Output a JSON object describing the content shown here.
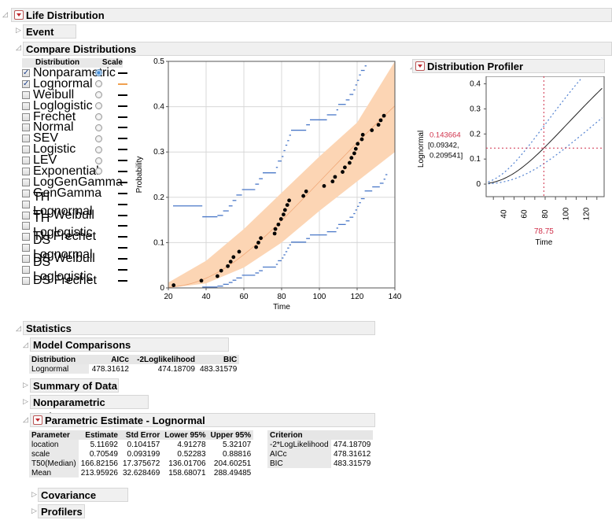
{
  "life_distribution": {
    "title": "Life Distribution"
  },
  "event_plot": {
    "title": "Event Plot"
  },
  "compare": {
    "title": "Compare Distributions",
    "col_distribution": "Distribution",
    "col_scale": "Scale",
    "distributions": [
      {
        "name": "Nonparametric",
        "checked": true,
        "scale": "on",
        "line_color": "#000000"
      },
      {
        "name": "Lognormal",
        "checked": true,
        "scale": "off",
        "line_color": "#f0a050"
      },
      {
        "name": "Weibull",
        "checked": false,
        "scale": "off",
        "line_color": "#000000"
      },
      {
        "name": "Loglogistic",
        "checked": false,
        "scale": "off",
        "line_color": "#000000"
      },
      {
        "name": "Frechet",
        "checked": false,
        "scale": "off",
        "line_color": "#000000"
      },
      {
        "name": "Normal",
        "checked": false,
        "scale": "off",
        "line_color": "#000000"
      },
      {
        "name": "SEV",
        "checked": false,
        "scale": "off",
        "line_color": "#000000"
      },
      {
        "name": "Logistic",
        "checked": false,
        "scale": "off",
        "line_color": "#000000"
      },
      {
        "name": "LEV",
        "checked": false,
        "scale": "off",
        "line_color": "#000000"
      },
      {
        "name": "Exponential",
        "checked": false,
        "scale": "off",
        "line_color": "#000000"
      },
      {
        "name": "LogGenGamma",
        "checked": false,
        "scale": "none",
        "line_color": "#000000"
      },
      {
        "name": "GenGamma",
        "checked": false,
        "scale": "none",
        "line_color": "#000000"
      },
      {
        "name": "TH Lognormal",
        "checked": false,
        "scale": "none",
        "line_color": "#000000"
      },
      {
        "name": "TH Weibull",
        "checked": false,
        "scale": "none",
        "line_color": "#000000"
      },
      {
        "name": "TH Loglogistic",
        "checked": false,
        "scale": "none",
        "line_color": "#000000"
      },
      {
        "name": "TH Frechet",
        "checked": false,
        "scale": "none",
        "line_color": "#000000"
      },
      {
        "name": "DS Lognormal",
        "checked": false,
        "scale": "none",
        "line_color": "#000000"
      },
      {
        "name": "DS Weibull",
        "checked": false,
        "scale": "none",
        "line_color": "#000000"
      },
      {
        "name": "DS Loglogistic",
        "checked": false,
        "scale": "none",
        "line_color": "#000000"
      },
      {
        "name": "DS Frechet",
        "checked": false,
        "scale": "none",
        "line_color": "#000000"
      }
    ],
    "check_glyph": "✓"
  },
  "chart_data": [
    {
      "type": "scatter",
      "title": "",
      "xlabel": "Time",
      "ylabel": "Probability",
      "xlim": [
        20,
        140
      ],
      "ylim": [
        0,
        0.5
      ],
      "xticks": [
        "20",
        "40",
        "60",
        "80",
        "100",
        "120",
        "140"
      ],
      "yticks": [
        "0",
        "0.1",
        "0.2",
        "0.3",
        "0.4",
        "0.5"
      ],
      "grid": true,
      "points": [
        [
          22.8,
          0.006
        ],
        [
          37.5,
          0.016
        ],
        [
          46,
          0.026
        ],
        [
          48,
          0.038
        ],
        [
          51.5,
          0.048
        ],
        [
          53,
          0.058
        ],
        [
          54.5,
          0.068
        ],
        [
          57.5,
          0.08
        ],
        [
          66.5,
          0.09
        ],
        [
          67.7,
          0.1
        ],
        [
          69,
          0.11
        ],
        [
          76.3,
          0.12
        ],
        [
          76.7,
          0.13
        ],
        [
          78.3,
          0.14
        ],
        [
          79.7,
          0.152
        ],
        [
          81,
          0.162
        ],
        [
          81.8,
          0.172
        ],
        [
          83,
          0.183
        ],
        [
          84,
          0.193
        ],
        [
          91.5,
          0.203
        ],
        [
          93,
          0.213
        ],
        [
          102.5,
          0.225
        ],
        [
          107,
          0.235
        ],
        [
          108.3,
          0.245
        ],
        [
          112.3,
          0.256
        ],
        [
          113.5,
          0.266
        ],
        [
          116,
          0.276
        ],
        [
          117,
          0.287
        ],
        [
          118.5,
          0.297
        ],
        [
          119.3,
          0.307
        ],
        [
          120.3,
          0.318
        ],
        [
          122.5,
          0.328
        ],
        [
          123,
          0.338
        ],
        [
          127.8,
          0.348
        ],
        [
          131.3,
          0.36
        ],
        [
          132.5,
          0.37
        ],
        [
          134.2,
          0.38
        ]
      ],
      "lognormal_fit": {
        "location": 5.11692,
        "scale": 0.70549
      },
      "band_upper": [
        [
          20,
          0.012
        ],
        [
          40,
          0.06
        ],
        [
          60,
          0.13
        ],
        [
          80,
          0.21
        ],
        [
          100,
          0.29
        ],
        [
          120,
          0.365
        ],
        [
          140,
          0.5
        ]
      ],
      "band_lower": [
        [
          20,
          0.0
        ],
        [
          40,
          0.01
        ],
        [
          60,
          0.045
        ],
        [
          80,
          0.1
        ],
        [
          100,
          0.17
        ],
        [
          120,
          0.235
        ],
        [
          140,
          0.3
        ]
      ],
      "upper_steps": [
        [
          22.5,
          38,
          0.181
        ],
        [
          38,
          46,
          0.157
        ],
        [
          46,
          49,
          0.16
        ],
        [
          49,
          52,
          0.17
        ],
        [
          52,
          54,
          0.181
        ],
        [
          54,
          56,
          0.193
        ],
        [
          56,
          59,
          0.205
        ],
        [
          59,
          66,
          0.217
        ],
        [
          66,
          68,
          0.229
        ],
        [
          68,
          70,
          0.241
        ],
        [
          70,
          77,
          0.254
        ],
        [
          77,
          78,
          0.266
        ],
        [
          78,
          80,
          0.28
        ],
        [
          80,
          81,
          0.29
        ],
        [
          81,
          82,
          0.303
        ],
        [
          82,
          83,
          0.315
        ],
        [
          83,
          84,
          0.325
        ],
        [
          84,
          85,
          0.337
        ],
        [
          85,
          93,
          0.348
        ],
        [
          93,
          95,
          0.36
        ],
        [
          95,
          104,
          0.371
        ],
        [
          104,
          109,
          0.382
        ],
        [
          109,
          110,
          0.393
        ],
        [
          110,
          114,
          0.405
        ],
        [
          114,
          116,
          0.415
        ],
        [
          116,
          118,
          0.427
        ],
        [
          118,
          119,
          0.437
        ],
        [
          119,
          120,
          0.448
        ],
        [
          120,
          121,
          0.458
        ],
        [
          121,
          122,
          0.47
        ],
        [
          122,
          124,
          0.48
        ],
        [
          124,
          125,
          0.49
        ]
      ],
      "lower_steps": [
        [
          38,
          46,
          0.002
        ],
        [
          46,
          49,
          0.004
        ],
        [
          49,
          52,
          0.008
        ],
        [
          52,
          54,
          0.012
        ],
        [
          54,
          56,
          0.017
        ],
        [
          56,
          59,
          0.022
        ],
        [
          59,
          66,
          0.028
        ],
        [
          66,
          68,
          0.033
        ],
        [
          68,
          70,
          0.038
        ],
        [
          70,
          77,
          0.046
        ],
        [
          77,
          78,
          0.052
        ],
        [
          78,
          80,
          0.06
        ],
        [
          80,
          81,
          0.066
        ],
        [
          81,
          82,
          0.073
        ],
        [
          82,
          83,
          0.08
        ],
        [
          83,
          84,
          0.088
        ],
        [
          84,
          85,
          0.095
        ],
        [
          85,
          93,
          0.101
        ],
        [
          93,
          95,
          0.109
        ],
        [
          95,
          104,
          0.117
        ],
        [
          104,
          109,
          0.124
        ],
        [
          109,
          110,
          0.132
        ],
        [
          110,
          114,
          0.14
        ],
        [
          114,
          116,
          0.148
        ],
        [
          116,
          118,
          0.156
        ],
        [
          118,
          119,
          0.164
        ],
        [
          119,
          120,
          0.172
        ],
        [
          120,
          121,
          0.18
        ],
        [
          121,
          122,
          0.188
        ],
        [
          122,
          124,
          0.197
        ],
        [
          124,
          128,
          0.214
        ],
        [
          128,
          132,
          0.223
        ],
        [
          132,
          134,
          0.231
        ],
        [
          134,
          135,
          0.24
        ],
        [
          135,
          136,
          0.25
        ]
      ]
    },
    {
      "type": "line",
      "title": "Distribution Profiler",
      "xlabel": "Time",
      "ylabel": "Lognormal",
      "xlim": [
        23,
        137
      ],
      "ylim": [
        -0.05,
        0.43
      ],
      "xticks": [
        "40",
        "60",
        "80",
        "100",
        "120"
      ],
      "yticks": [
        "0",
        "0.1",
        "0.2",
        "0.3",
        "0.4"
      ],
      "current_x": 78.75,
      "current_y": 0.143664,
      "ci": [
        0.09342,
        0.209541
      ]
    }
  ],
  "profiler": {
    "title": "Distribution Profiler",
    "ylabel": "Lognormal",
    "value": "0.143664",
    "ci_line1": "[0.09342,",
    "ci_line2": "0.209541]",
    "xvalue": "78.75",
    "xlabel": "Time"
  },
  "statistics": {
    "title": "Statistics",
    "model_comparisons": {
      "title": "Model Comparisons",
      "headers": [
        "Distribution",
        "AICc",
        "-2Loglikelihood",
        "BIC"
      ],
      "rows": [
        [
          "Lognormal",
          "478.31612",
          "474.18709",
          "483.31579"
        ]
      ]
    },
    "summary_of_data": "Summary of Data",
    "nonparametric_estimate": "Nonparametric Estimate",
    "parametric": {
      "title": "Parametric Estimate - Lognormal",
      "headers": [
        "Parameter",
        "Estimate",
        "Std Error",
        "Lower 95%",
        "Upper 95%"
      ],
      "rows": [
        [
          "location",
          "5.11692",
          "0.104157",
          "4.91278",
          "5.32107"
        ],
        [
          "scale",
          "0.70549",
          "0.093199",
          "0.52283",
          "0.88816"
        ],
        [
          "T50(Median)",
          "166.82156",
          "17.375672",
          "136.01706",
          "204.60251"
        ],
        [
          "Mean",
          "213.95926",
          "32.628469",
          "158.68071",
          "288.49485"
        ]
      ],
      "criterion_header": "Criterion",
      "criteria": [
        [
          "-2*LogLikelihood",
          "474.18709"
        ],
        [
          "AICc",
          "478.31612"
        ],
        [
          "BIC",
          "483.31579"
        ]
      ]
    },
    "covariance_matrix": "Covariance Matrix",
    "profilers": "Profilers"
  },
  "colors": {
    "band": "#fcd5b4",
    "fit_line": "#f0a878",
    "steps": "#4a78c8",
    "points": "#000000",
    "crosshair": "#d0304a",
    "profiler_ci": "#5080d0"
  }
}
